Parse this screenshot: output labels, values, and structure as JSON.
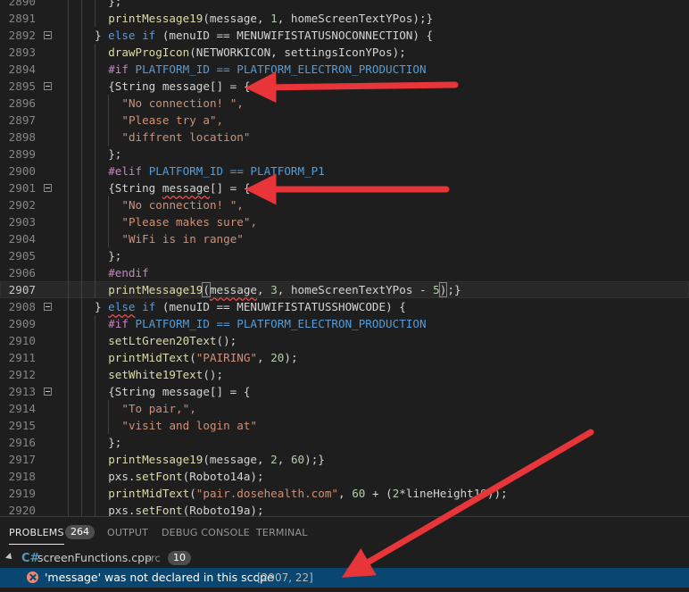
{
  "editor": {
    "current_line": "2907",
    "lines": [
      {
        "n": "2890",
        "fold": false,
        "indent": 7,
        "segs": [
          {
            "t": "};",
            "c": "pl"
          }
        ]
      },
      {
        "n": "2891",
        "fold": false,
        "indent": 7,
        "segs": [
          {
            "t": "printMessage19",
            "c": "fn"
          },
          {
            "t": "(message, ",
            "c": "pl"
          },
          {
            "t": "1",
            "c": "num"
          },
          {
            "t": ", homeScreenTextYPos);}",
            "c": "pl"
          }
        ]
      },
      {
        "n": "2892",
        "fold": true,
        "indent": 5,
        "segs": [
          {
            "t": "} ",
            "c": "pl"
          },
          {
            "t": "else if",
            "c": "kw"
          },
          {
            "t": " (menuID == MENUWIFISTATUSNOCONNECTION) {",
            "c": "pl"
          }
        ]
      },
      {
        "n": "2893",
        "fold": false,
        "indent": 7,
        "segs": [
          {
            "t": "drawProgIcon",
            "c": "fn"
          },
          {
            "t": "(NETWORKICON, settingsIconYPos);",
            "c": "pl"
          }
        ]
      },
      {
        "n": "2894",
        "fold": false,
        "indent": 7,
        "segs": [
          {
            "t": "#if",
            "c": "pp"
          },
          {
            "t": " PLATFORM_ID == PLATFORM_ELECTRON_PRODUCTION",
            "c": "kw"
          }
        ]
      },
      {
        "n": "2895",
        "fold": true,
        "indent": 7,
        "segs": [
          {
            "t": "{String message[] = {",
            "c": "pl"
          }
        ]
      },
      {
        "n": "2896",
        "fold": false,
        "indent": 9,
        "segs": [
          {
            "t": "\"No connection! \",",
            "c": "str"
          }
        ]
      },
      {
        "n": "2897",
        "fold": false,
        "indent": 9,
        "segs": [
          {
            "t": "\"Please try a\",",
            "c": "str"
          }
        ]
      },
      {
        "n": "2898",
        "fold": false,
        "indent": 9,
        "segs": [
          {
            "t": "\"diffrent location\"",
            "c": "str"
          }
        ]
      },
      {
        "n": "2899",
        "fold": false,
        "indent": 7,
        "segs": [
          {
            "t": "};",
            "c": "pl"
          }
        ]
      },
      {
        "n": "2900",
        "fold": false,
        "indent": 7,
        "segs": [
          {
            "t": "#elif",
            "c": "pp"
          },
          {
            "t": " PLATFORM_ID == PLATFORM_P1",
            "c": "kw"
          }
        ]
      },
      {
        "n": "2901",
        "fold": true,
        "indent": 7,
        "segs": [
          {
            "t": "{String ",
            "c": "pl"
          },
          {
            "t": "message",
            "c": "sq"
          },
          {
            "t": "[] = {",
            "c": "pl"
          }
        ]
      },
      {
        "n": "2902",
        "fold": false,
        "indent": 9,
        "segs": [
          {
            "t": "\"No connection! \",",
            "c": "str"
          }
        ]
      },
      {
        "n": "2903",
        "fold": false,
        "indent": 9,
        "segs": [
          {
            "t": "\"Please makes sure\",",
            "c": "str"
          }
        ]
      },
      {
        "n": "2904",
        "fold": false,
        "indent": 9,
        "segs": [
          {
            "t": "\"WiFi is in range\"",
            "c": "str"
          }
        ]
      },
      {
        "n": "2905",
        "fold": false,
        "indent": 7,
        "segs": [
          {
            "t": "};",
            "c": "pl"
          }
        ]
      },
      {
        "n": "2906",
        "fold": false,
        "indent": 7,
        "segs": [
          {
            "t": "#endif",
            "c": "pp"
          }
        ]
      },
      {
        "n": "2907",
        "fold": false,
        "indent": 7,
        "segs": [
          {
            "t": "printMessage19",
            "c": "fn"
          },
          {
            "t": "(",
            "c": "hl"
          },
          {
            "t": "message",
            "c": "sq"
          },
          {
            "t": ", ",
            "c": "pl"
          },
          {
            "t": "3",
            "c": "num"
          },
          {
            "t": ", homeScreenTextYPos - ",
            "c": "pl"
          },
          {
            "t": "5",
            "c": "num"
          },
          {
            "t": ")",
            "c": "hl"
          },
          {
            "t": "",
            "c": "cur"
          },
          {
            "t": ";}",
            "c": "pl"
          }
        ]
      },
      {
        "n": "2908",
        "fold": true,
        "indent": 5,
        "segs": [
          {
            "t": "} ",
            "c": "pl"
          },
          {
            "t": "else",
            "c": "kwsq"
          },
          {
            "t": " ",
            "c": "pl"
          },
          {
            "t": "if",
            "c": "kw"
          },
          {
            "t": " (menuID == MENUWIFISTATUSSHOWCODE) {",
            "c": "pl"
          }
        ]
      },
      {
        "n": "2909",
        "fold": false,
        "indent": 7,
        "segs": [
          {
            "t": "#if",
            "c": "pp"
          },
          {
            "t": " PLATFORM_ID == PLATFORM_ELECTRON_PRODUCTION",
            "c": "kw"
          }
        ]
      },
      {
        "n": "2910",
        "fold": false,
        "indent": 7,
        "segs": [
          {
            "t": "setLtGreen20Text",
            "c": "fn"
          },
          {
            "t": "();",
            "c": "pl"
          }
        ]
      },
      {
        "n": "2911",
        "fold": false,
        "indent": 7,
        "segs": [
          {
            "t": "printMidText",
            "c": "fn"
          },
          {
            "t": "(",
            "c": "pl"
          },
          {
            "t": "\"PAIRING\"",
            "c": "str"
          },
          {
            "t": ", ",
            "c": "pl"
          },
          {
            "t": "20",
            "c": "num"
          },
          {
            "t": ");",
            "c": "pl"
          }
        ]
      },
      {
        "n": "2912",
        "fold": false,
        "indent": 7,
        "segs": [
          {
            "t": "setWhite19Text",
            "c": "fn"
          },
          {
            "t": "();",
            "c": "pl"
          }
        ]
      },
      {
        "n": "2913",
        "fold": true,
        "indent": 7,
        "segs": [
          {
            "t": "{String message[] = {",
            "c": "pl"
          }
        ]
      },
      {
        "n": "2914",
        "fold": false,
        "indent": 9,
        "segs": [
          {
            "t": "\"To pair,\",",
            "c": "str"
          }
        ]
      },
      {
        "n": "2915",
        "fold": false,
        "indent": 9,
        "segs": [
          {
            "t": "\"visit and login at\"",
            "c": "str"
          }
        ]
      },
      {
        "n": "2916",
        "fold": false,
        "indent": 7,
        "segs": [
          {
            "t": "};",
            "c": "pl"
          }
        ]
      },
      {
        "n": "2917",
        "fold": false,
        "indent": 7,
        "segs": [
          {
            "t": "printMessage19",
            "c": "fn"
          },
          {
            "t": "(message, ",
            "c": "pl"
          },
          {
            "t": "2",
            "c": "num"
          },
          {
            "t": ", ",
            "c": "pl"
          },
          {
            "t": "60",
            "c": "num"
          },
          {
            "t": ");}",
            "c": "pl"
          }
        ]
      },
      {
        "n": "2918",
        "fold": false,
        "indent": 7,
        "segs": [
          {
            "t": "pxs.",
            "c": "pl"
          },
          {
            "t": "setFont",
            "c": "fn"
          },
          {
            "t": "(Roboto14a);",
            "c": "pl"
          }
        ]
      },
      {
        "n": "2919",
        "fold": false,
        "indent": 7,
        "segs": [
          {
            "t": "printMidText",
            "c": "fn"
          },
          {
            "t": "(",
            "c": "pl"
          },
          {
            "t": "\"pair.dosehealth.com\"",
            "c": "str"
          },
          {
            "t": ", ",
            "c": "pl"
          },
          {
            "t": "60",
            "c": "num"
          },
          {
            "t": " + (",
            "c": "pl"
          },
          {
            "t": "2",
            "c": "num"
          },
          {
            "t": "*lineHeight1",
            "c": "pl"
          },
          {
            "t": "9",
            "c": "num"
          },
          {
            "t": "));",
            "c": "pl"
          }
        ]
      },
      {
        "n": "2920",
        "fold": false,
        "indent": 7,
        "segs": [
          {
            "t": "pxs.",
            "c": "pl"
          },
          {
            "t": "setFont",
            "c": "fn"
          },
          {
            "t": "(Roboto19a);",
            "c": "pl"
          }
        ]
      }
    ]
  },
  "panel": {
    "tabs": [
      "PROBLEMS",
      "OUTPUT",
      "DEBUG CONSOLE",
      "TERMINAL"
    ],
    "problem_count": "264",
    "file": {
      "icon": "C#",
      "name": "screenFunctions.cpp",
      "dir": "src",
      "count": "10"
    },
    "error": {
      "message": "'message' was not declared in this scope",
      "location": "[2907, 22]"
    }
  },
  "colors": {
    "background": "#1e1e1e",
    "error_selection": "#094771",
    "annotation_arrow": "#e8353a"
  }
}
